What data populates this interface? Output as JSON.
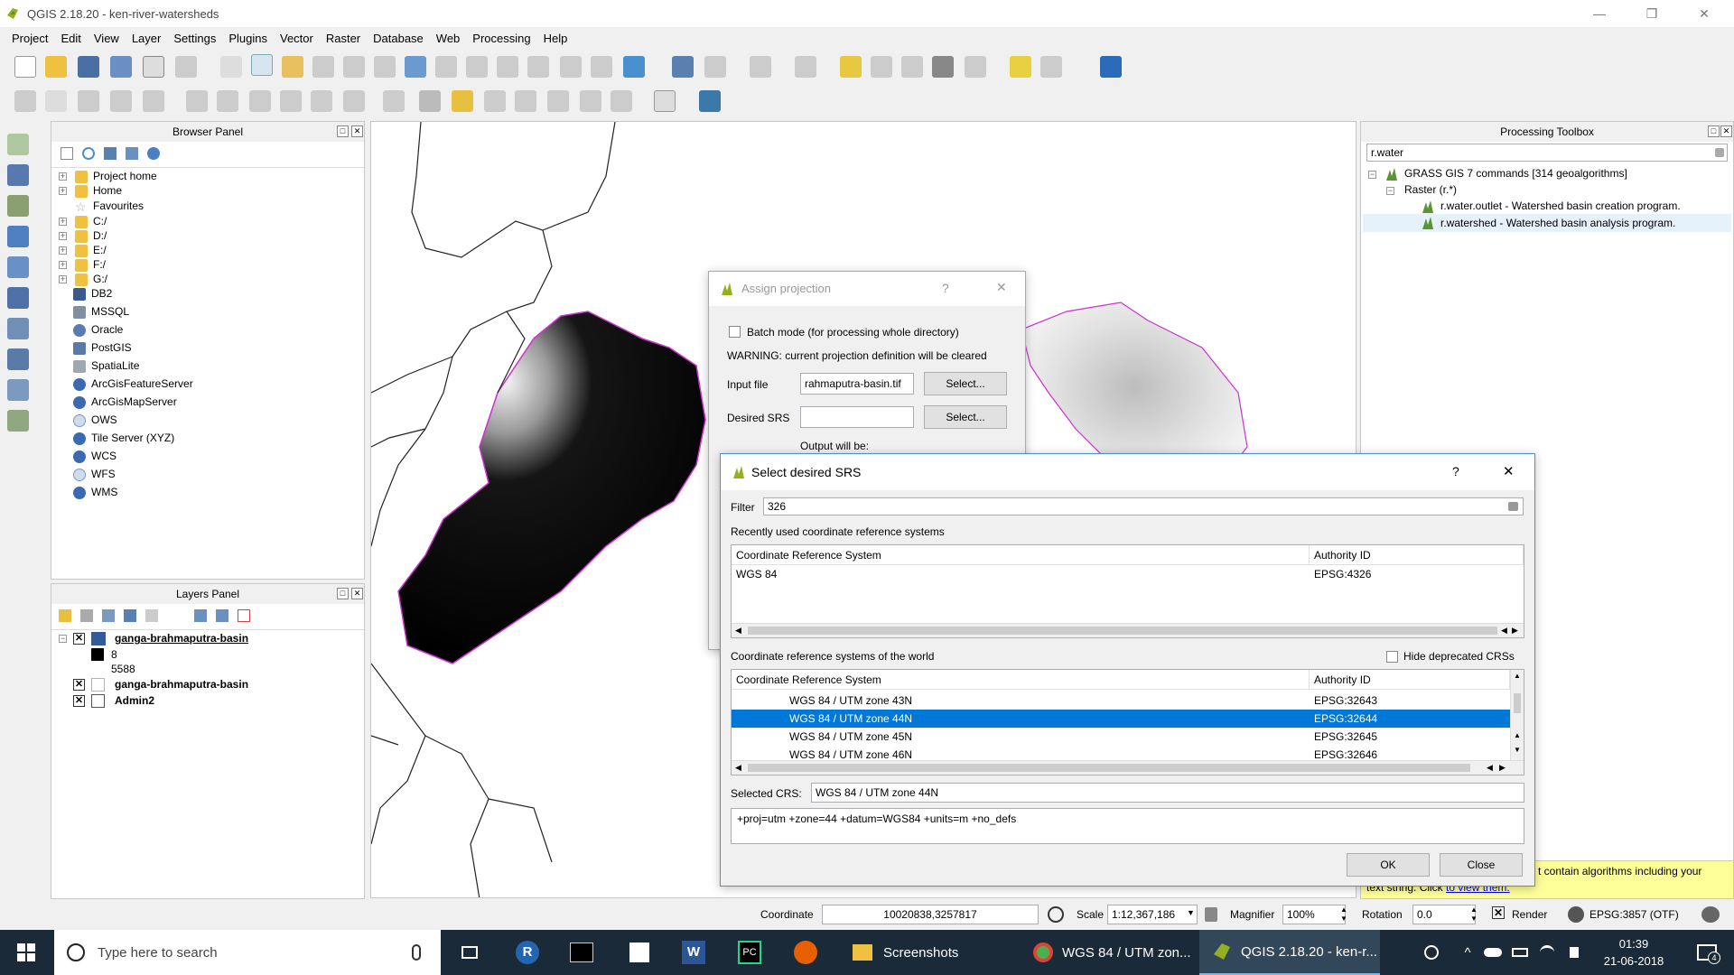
{
  "window": {
    "title": "QGIS 2.18.20 - ken-river-watersheds",
    "minimize": "—",
    "restore": "❐",
    "close": "✕"
  },
  "menu": [
    "Project",
    "Edit",
    "View",
    "Layer",
    "Settings",
    "Plugins",
    "Vector",
    "Raster",
    "Database",
    "Web",
    "Processing",
    "Help"
  ],
  "browser_panel": {
    "title": "Browser Panel",
    "items": [
      "Project home",
      "Home",
      "Favourites",
      "C:/",
      "D:/",
      "E:/",
      "F:/",
      "G:/",
      "DB2",
      "MSSQL",
      "Oracle",
      "PostGIS",
      "SpatiaLite",
      "ArcGisFeatureServer",
      "ArcGisMapServer",
      "OWS",
      "Tile Server (XYZ)",
      "WCS",
      "WFS",
      "WMS"
    ]
  },
  "layers_panel": {
    "title": "Layers Panel",
    "layers": [
      {
        "name": "ganga-brahmaputra-basin",
        "checked": true
      },
      {
        "name": "8"
      },
      {
        "name": "5588"
      },
      {
        "name": "ganga-brahmaputra-basin",
        "checked": true
      },
      {
        "name": "Admin2",
        "checked": true
      }
    ]
  },
  "processing_toolbox": {
    "title": "Processing Toolbox",
    "search": "r.water",
    "group": "GRASS GIS 7 commands [314 geoalgorithms]",
    "subgroup": "Raster (r.*)",
    "algorithms": [
      "r.water.outlet - Watershed basin creation program.",
      "r.watershed - Watershed basin analysis program."
    ],
    "notice": "t contain algorithms including your",
    "notice2": "text string. Click",
    "notice_link": "to view them."
  },
  "assign_projection": {
    "title": "Assign projection",
    "help": "?",
    "close": "✕",
    "batch_label": "Batch mode (for processing whole directory)",
    "warning": "WARNING: current projection definition will be cleared",
    "input_label": "Input file",
    "input_value": "rahmaputra-basin.tif",
    "select": "Select...",
    "srs_label": "Desired SRS",
    "srs_value": "",
    "output_label": "Output will be:"
  },
  "select_srs": {
    "title": "Select desired SRS",
    "help": "?",
    "close": "✕",
    "filter_label": "Filter",
    "filter_value": "326",
    "recent_label": "Recently used coordinate reference systems",
    "col_crs": "Coordinate Reference System",
    "col_auth": "Authority ID",
    "recent_rows": [
      {
        "crs": "WGS 84",
        "auth": "EPSG:4326"
      }
    ],
    "world_label": "Coordinate reference systems of the world",
    "hide_deprecated": "Hide deprecated CRSs",
    "world_rows": [
      {
        "crs": "WGS 84 / UTM zone 43N",
        "auth": "EPSG:32643",
        "selected": false
      },
      {
        "crs": "WGS 84 / UTM zone 44N",
        "auth": "EPSG:32644",
        "selected": true
      },
      {
        "crs": "WGS 84 / UTM zone 45N",
        "auth": "EPSG:32645",
        "selected": false
      },
      {
        "crs": "WGS 84 / UTM zone 46N",
        "auth": "EPSG:32646",
        "selected": false
      }
    ],
    "selected_label": "Selected CRS:",
    "selected_value": "WGS 84 / UTM zone 44N",
    "proj_string": "+proj=utm +zone=44 +datum=WGS84 +units=m +no_defs",
    "ok": "OK",
    "close_btn": "Close"
  },
  "statusbar": {
    "coordinate_label": "Coordinate",
    "coordinate_value": "10020838,3257817",
    "scale_label": "Scale",
    "scale_value": "1:12,367,186",
    "magnifier_label": "Magnifier",
    "magnifier_value": "100%",
    "rotation_label": "Rotation",
    "rotation_value": "0.0",
    "render_label": "Render",
    "crs_label": "EPSG:3857 (OTF)"
  },
  "taskbar": {
    "search_placeholder": "Type here to search",
    "items": [
      "Screenshots",
      "WGS 84 / UTM zon...",
      "QGIS 2.18.20 - ken-r..."
    ],
    "time": "01:39",
    "date": "21-06-2018",
    "notif_count": "4"
  },
  "colors": {
    "selection": "#0078d7",
    "qgis_green": "#589632",
    "taskbar": "#1b2a38",
    "notice_bg": "#ffff99"
  }
}
